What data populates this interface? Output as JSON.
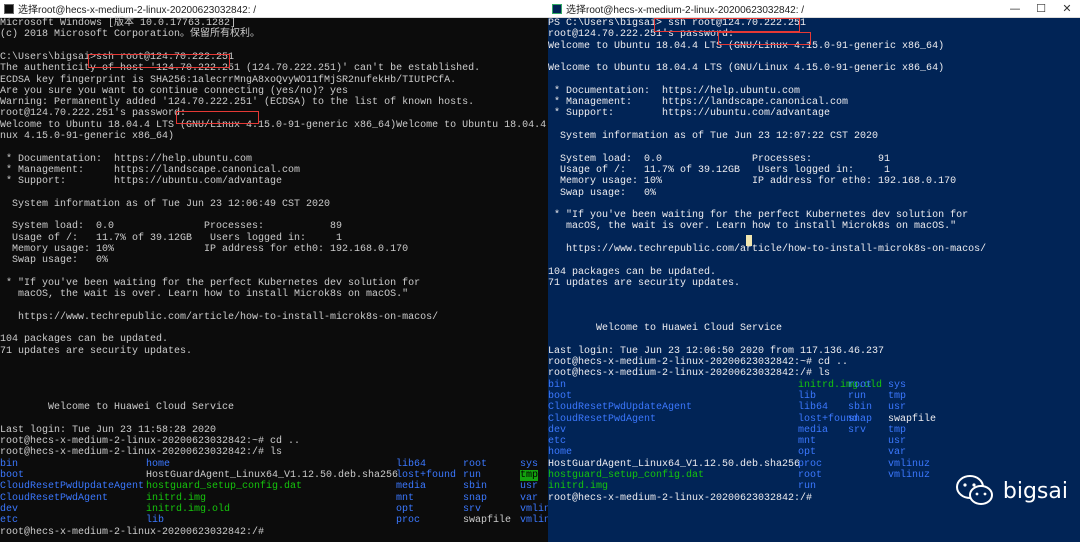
{
  "left_window": {
    "title": "选择root@hecs-x-medium-2-linux-20200623032842: /",
    "lines": [
      "Microsoft Windows [版本 10.0.17763.1282]",
      "(c) 2018 Microsoft Corporation。保留所有权利。",
      "",
      "C:\\Users\\bigsai>ssh root@124.70.222.251",
      "The authenticity of host '124.70.222.251 (124.70.222.251)' can't be established.",
      "ECDSA key fingerprint is SHA256:1alecrrMngA8xoQvyWO11fMjSR2nufekHb/TIUtPCfA.",
      "Are you sure you want to continue connecting (yes/no)? yes",
      "Warning: Permanently added '124.70.222.251' (ECDSA) to the list of known hosts.",
      "root@124.70.222.251's password:",
      "Welcome to Ubuntu 18.04.4 LTS (GNU/Linux 4.15.0-91-generic x86_64)Welcome to Ubuntu 18.04.4 LTS (GNU/Li",
      "nux 4.15.0-91-generic x86_64)",
      "",
      " * Documentation:  https://help.ubuntu.com",
      " * Management:     https://landscape.canonical.com",
      " * Support:        https://ubuntu.com/advantage",
      "",
      "  System information as of Tue Jun 23 12:06:49 CST 2020",
      "",
      "  System load:  0.0               Processes:           89",
      "  Usage of /:   11.7% of 39.12GB   Users logged in:     1",
      "  Memory usage: 10%               IP address for eth0: 192.168.0.170",
      "  Swap usage:   0%",
      "",
      " * \"If you've been waiting for the perfect Kubernetes dev solution for",
      "   macOS, the wait is over. Learn how to install Microk8s on macOS.\"",
      "",
      "   https://www.techrepublic.com/article/how-to-install-microk8s-on-macos/",
      "",
      "104 packages can be updated.",
      "71 updates are security updates.",
      "",
      "",
      "",
      "",
      "        Welcome to Huawei Cloud Service",
      "",
      "Last login: Tue Jun 23 11:58:28 2020",
      "root@hecs-x-medium-2-linux-20200623032842:~# cd ..",
      "root@hecs-x-medium-2-linux-20200623032842:/# ls"
    ],
    "ls_rows": [
      [
        "bin",
        "home",
        "lib64",
        "root",
        "sys"
      ],
      [
        "boot",
        "HostGuardAgent_Linux64_V1.12.50.deb.sha256",
        "lost+found",
        "run",
        "tmp"
      ],
      [
        "CloudResetPwdUpdateAgent",
        "hostguard_setup_config.dat",
        "media",
        "sbin",
        "usr"
      ],
      [
        "CloudResetPwdAgent",
        "initrd.img",
        "mnt",
        "snap",
        "var"
      ],
      [
        "dev",
        "initrd.img.old",
        "opt",
        "srv",
        "vmlin"
      ],
      [
        "etc",
        "lib",
        "proc",
        "swapfile",
        "vmlin"
      ]
    ],
    "final_prompt": "root@hecs-x-medium-2-linux-20200623032842:/#"
  },
  "right_window": {
    "title": "选择root@hecs-x-medium-2-linux-20200623032842: /",
    "lines": [
      "PS C:\\Users\\bigsai> ssh root@124.70.222.251",
      "root@124.70.222.251's password:",
      "Welcome to Ubuntu 18.04.4 LTS (GNU/Linux 4.15.0-91-generic x86_64)",
      "",
      "Welcome to Ubuntu 18.04.4 LTS (GNU/Linux 4.15.0-91-generic x86_64)",
      "",
      " * Documentation:  https://help.ubuntu.com",
      " * Management:     https://landscape.canonical.com",
      " * Support:        https://ubuntu.com/advantage",
      "",
      "  System information as of Tue Jun 23 12:07:22 CST 2020",
      "",
      "  System load:  0.0               Processes:           91",
      "  Usage of /:   11.7% of 39.12GB   Users logged in:     1",
      "  Memory usage: 10%               IP address for eth0: 192.168.0.170",
      "  Swap usage:   0%",
      "",
      " * \"If you've been waiting for the perfect Kubernetes dev solution for",
      "   macOS, the wait is over. Learn how to install Microk8s on macOS.\"",
      "",
      "   https://www.techrepublic.com/article/how-to-install-microk8s-on-macos/",
      "",
      "104 packages can be updated.",
      "71 updates are security updates.",
      "",
      "",
      "",
      "        Welcome to Huawei Cloud Service",
      "",
      "Last login: Tue Jun 23 12:06:50 2020 from 117.136.46.237",
      "root@hecs-x-medium-2-linux-20200623032842:~# cd ..",
      "root@hecs-x-medium-2-linux-20200623032842:/# ls"
    ],
    "ls_rows": [
      [
        "bin",
        "",
        "initrd.img.old",
        "root",
        "sys"
      ],
      [
        "boot",
        "",
        "lib",
        "run",
        "tmp"
      ],
      [
        "CloudResetPwdUpdateAgent",
        "",
        "lib64",
        "sbin",
        "usr"
      ],
      [
        "CloudResetPwdAgent",
        "",
        "lost+found",
        "snap",
        "swapfile"
      ],
      [
        "dev",
        "",
        "media",
        "srv",
        "tmp"
      ],
      [
        "etc",
        "",
        "mnt",
        "",
        "usr"
      ],
      [
        "home",
        "",
        "opt",
        "",
        "var"
      ],
      [
        "HostGuardAgent_Linux64_V1.12.50.deb.sha256",
        "",
        "proc",
        "",
        "vmlinuz"
      ],
      [
        "hostguard_setup_config.dat",
        "",
        "root",
        "",
        "vmlinuz"
      ],
      [
        "initrd.img",
        "",
        "run",
        "",
        ""
      ]
    ],
    "final_prompt": "root@hecs-x-medium-2-linux-20200623032842:/#"
  },
  "watermark": {
    "text": "bigsai",
    "icon": "wechat-icon"
  },
  "colors": {
    "cmd_bg": "#0c0c0c",
    "ps_bg": "#012456",
    "dir_blue": "#3b78ff",
    "exec_green": "#16c60c",
    "highlight_box": "#e53935"
  },
  "window_buttons": {
    "minimize": "—",
    "maximize": "☐",
    "close": "✕"
  }
}
